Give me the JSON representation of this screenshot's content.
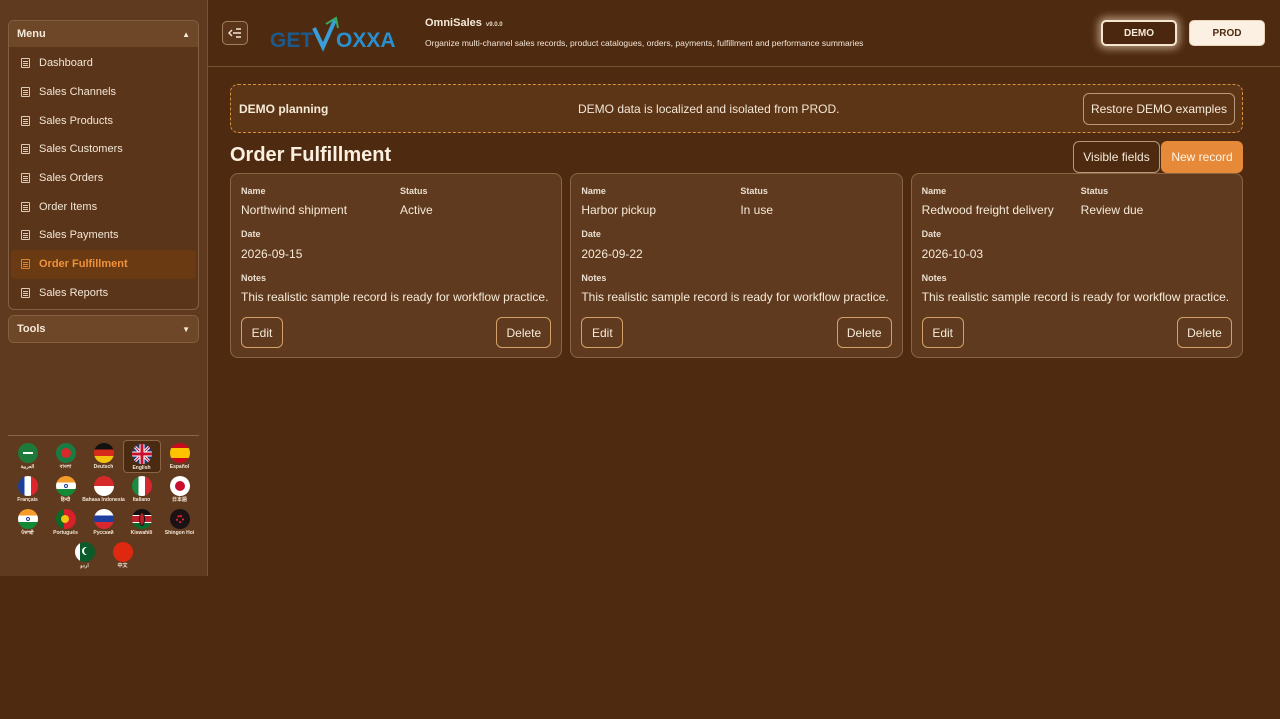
{
  "sidebar": {
    "menu_title": "Menu",
    "tools_title": "Tools",
    "items": [
      {
        "label": "Dashboard"
      },
      {
        "label": "Sales Channels"
      },
      {
        "label": "Sales Products"
      },
      {
        "label": "Sales Customers"
      },
      {
        "label": "Sales Orders"
      },
      {
        "label": "Order Items"
      },
      {
        "label": "Sales Payments"
      },
      {
        "label": "Order Fulfillment"
      },
      {
        "label": "Sales Reports"
      }
    ],
    "active_item": "Order Fulfillment",
    "languages": [
      {
        "label": "العربية"
      },
      {
        "label": "বাংলা"
      },
      {
        "label": "Deutsch"
      },
      {
        "label": "English"
      },
      {
        "label": "Español"
      },
      {
        "label": "Français"
      },
      {
        "label": "हिन्दी"
      },
      {
        "label": "Bahasa Indonesia"
      },
      {
        "label": "Italiano"
      },
      {
        "label": "日本語"
      },
      {
        "label": "ਪੰਜਾਬੀ"
      },
      {
        "label": "Português"
      },
      {
        "label": "Русский"
      },
      {
        "label": "Kiswahili"
      },
      {
        "label": "Shingon Hoi"
      },
      {
        "label": "اردو"
      },
      {
        "label": "中文"
      }
    ],
    "selected_language": "English"
  },
  "header": {
    "toggle_icon": "sidebar-collapse-icon",
    "logo_text_left": "GET",
    "logo_text_right": "OXXA",
    "app_name": "OmniSales",
    "version": "v9.0.0",
    "description": "Organize multi-channel sales records, product catalogues, orders, payments, fulfillment and performance summaries",
    "env_demo": "DEMO",
    "env_prod": "PROD"
  },
  "banner": {
    "title": "DEMO planning",
    "message": "DEMO data is localized and isolated from PROD.",
    "restore_label": "Restore DEMO examples"
  },
  "page": {
    "title": "Order Fulfillment",
    "visible_fields_label": "Visible fields",
    "new_record_label": "New record"
  },
  "labels": {
    "name": "Name",
    "status": "Status",
    "date": "Date",
    "notes": "Notes",
    "edit": "Edit",
    "delete": "Delete"
  },
  "records": [
    {
      "name": "Northwind shipment",
      "status": "Active",
      "date": "2026-09-15",
      "notes": "This realistic sample record is ready for workflow practice."
    },
    {
      "name": "Harbor pickup",
      "status": "In use",
      "date": "2026-09-22",
      "notes": "This realistic sample record is ready for workflow practice."
    },
    {
      "name": "Redwood freight delivery",
      "status": "Review due",
      "date": "2026-10-03",
      "notes": "This realistic sample record is ready for workflow practice."
    }
  ],
  "colors": {
    "background": "#4e2a10",
    "accent": "#e68a3a",
    "active_menu_text": "#f0913a"
  }
}
